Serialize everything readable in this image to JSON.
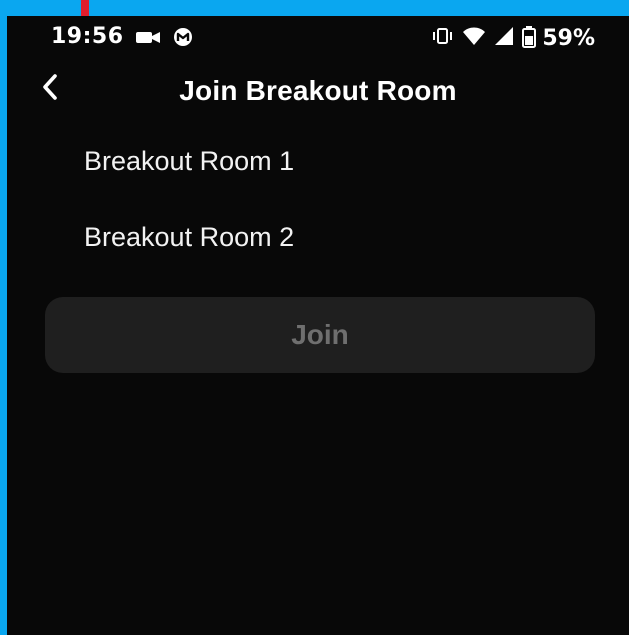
{
  "status_bar": {
    "time": "19:56",
    "battery": "59%",
    "left_icons": [
      "video-camera-icon",
      "malwarebytes-icon"
    ],
    "right_icons": [
      "vibrate-icon",
      "wifi-icon",
      "signal-icon",
      "battery-icon"
    ]
  },
  "header": {
    "title": "Join Breakout Room",
    "back_icon": "back-chevron-icon"
  },
  "rooms": [
    {
      "label": "Breakout Room 1"
    },
    {
      "label": "Breakout Room 2"
    }
  ],
  "join_button": {
    "label": "Join",
    "enabled": false
  },
  "colors": {
    "outer_border": "#0aa7f0",
    "screen_background": "#080808",
    "button_background": "#1f1f1f",
    "disabled_text": "#6f6f6f",
    "annotation_arrow": "#e21d2c"
  }
}
